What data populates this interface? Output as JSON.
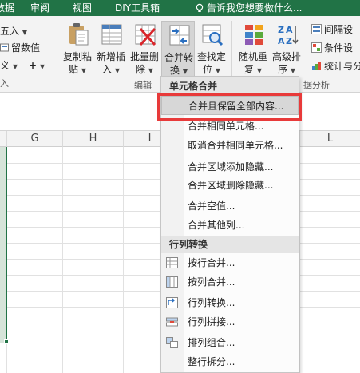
{
  "tabs": [
    {
      "label": "数据"
    },
    {
      "label": "审阅"
    },
    {
      "label": "视图"
    },
    {
      "label": "DIY工具箱"
    },
    {
      "label": "告诉我您想要做什么..."
    }
  ],
  "ribbon_left": {
    "items": [
      "五入",
      "留数值",
      "义",
      "入"
    ]
  },
  "buttons": [
    {
      "line1": "复制粘",
      "line2": "贴"
    },
    {
      "line1": "新增插",
      "line2": "入"
    },
    {
      "line1": "批量删",
      "line2": "除"
    },
    {
      "line1": "合并转",
      "line2": "换"
    },
    {
      "line1": "查找定",
      "line2": "位"
    },
    {
      "line1": "随机重",
      "line2": "复"
    },
    {
      "line1": "高级排",
      "line2": "序"
    }
  ],
  "group_labels": {
    "edit": "编辑",
    "analysis": "据分析"
  },
  "ribbon_right": {
    "items": [
      "间隔设",
      "条件设",
      "统计与分"
    ]
  },
  "columns": [
    "G",
    "H",
    "I",
    "L"
  ],
  "menu": {
    "section1": "单元格合并",
    "section1_items": [
      "合并且保留全部内容...",
      "合并相同单元格...",
      "取消合并相同单元格...",
      "合并区域添加隐藏...",
      "合并区域删除隐藏...",
      "合并空值...",
      "合并其他列..."
    ],
    "section2": "行列转换",
    "section2_items": [
      "按行合并...",
      "按列合并...",
      "行列转换...",
      "行列拼接...",
      "排列组合...",
      "整行拆分..."
    ]
  },
  "colors": {
    "accent": "#217346",
    "highlight_box": "#e83a3a"
  }
}
